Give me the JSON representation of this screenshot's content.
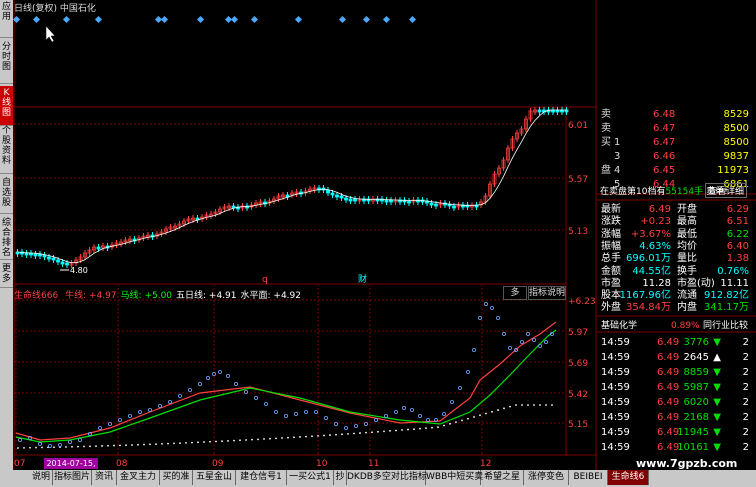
{
  "left_tabs": [
    {
      "label": "应用",
      "active": false
    },
    {
      "label": "分时图",
      "active": false
    },
    {
      "label": "K线图",
      "active": true
    },
    {
      "label": "个股资料",
      "active": false
    },
    {
      "label": "自选股",
      "active": false
    },
    {
      "label": "综合排名",
      "active": false
    },
    {
      "label": "更多",
      "active": false
    }
  ],
  "title": {
    "period": "日线(复权)",
    "name": "中国石化"
  },
  "kline_axis": [
    "6.01",
    "5.57",
    "5.13"
  ],
  "kline_low_label": "4.80",
  "marker_q": "q",
  "marker_cai": "财",
  "indicator_header": {
    "name": "生命线666",
    "items": [
      {
        "label": "牛线:",
        "value": "+4.97",
        "color": "#ff4040"
      },
      {
        "label": "马线:",
        "value": "+5.00",
        "color": "#00ff00"
      },
      {
        "label": "五日线:",
        "value": "+4.91",
        "color": "#ffffff"
      },
      {
        "label": "水平面:",
        "value": "+4.92",
        "color": "#ffffff"
      }
    ],
    "btn1": "多",
    "btn2": "指标说明"
  },
  "indicator_axis": [
    "+6.23",
    "5.97",
    "5.69",
    "5.42",
    "5.15"
  ],
  "xaxis": [
    "07",
    "08",
    "09",
    "10",
    "11",
    "12"
  ],
  "date_label": "2014-07-15,二",
  "order_book": [
    {
      "side": "卖",
      "level": "",
      "price": "6.48",
      "vol": "8529"
    },
    {
      "side": "卖",
      "level": "",
      "price": "6.47",
      "vol": "8500"
    },
    {
      "side": "买",
      "level": "1",
      "price": "6.47",
      "vol": "8500"
    },
    {
      "side": "",
      "level": "3",
      "price": "6.46",
      "vol": "9837"
    },
    {
      "side": "盘",
      "level": "4",
      "price": "6.45",
      "vol": "11973"
    },
    {
      "side": "",
      "level": "5",
      "price": "6.44",
      "vol": "6861"
    }
  ],
  "order_book_side_labels": [
    "买",
    "盘"
  ],
  "sell_info": {
    "text": "在卖盘第10档有",
    "vol": "55154手",
    "suffix": "卖单!",
    "btn": "查看详细"
  },
  "quote_rows": [
    {
      "l1": "最新",
      "v1": "6.49",
      "l2": "开盘",
      "v2": "6.29",
      "c1": "red",
      "c2": "red"
    },
    {
      "l1": "涨跌",
      "v1": "+0.23",
      "l2": "最高",
      "v2": "6.51",
      "c1": "red",
      "c2": "red"
    },
    {
      "l1": "涨幅",
      "v1": "+3.67%",
      "l2": "最低",
      "v2": "6.22",
      "c1": "red",
      "c2": "grn"
    },
    {
      "l1": "振幅",
      "v1": "4.63%",
      "l2": "均价",
      "v2": "6.40",
      "c1": "cyan",
      "c2": "red"
    },
    {
      "l1": "总手",
      "v1": "696.01万",
      "l2": "量比",
      "v2": "1.38",
      "c1": "cyan",
      "c2": "red"
    },
    {
      "l1": "金额",
      "v1": "44.55亿",
      "l2": "换手",
      "v2": "0.76%",
      "c1": "cyan",
      "c2": "cyan"
    },
    {
      "l1": "市盈",
      "v1": "11.28",
      "l2": "市盈(动)",
      "v2": "11.11",
      "c1": "wht",
      "c2": "wht"
    },
    {
      "l1": "股本",
      "v1": "1167.96亿",
      "l2": "流通",
      "v2": "912.82亿",
      "c1": "cyan",
      "c2": "cyan"
    },
    {
      "l1": "外盘",
      "v1": "354.84万",
      "l2": "内盘",
      "v2": "341.17万",
      "c1": "red",
      "c2": "grn"
    }
  ],
  "sector": {
    "name": "基础化学",
    "pct": "0.89%",
    "btn": "同行业比较"
  },
  "ticks": [
    {
      "time": "14:59",
      "price": "6.49",
      "vol": "3776",
      "dir": "down",
      "n": "2"
    },
    {
      "time": "14:59",
      "price": "6.49",
      "vol": "2645",
      "dir": "up",
      "n": "2"
    },
    {
      "time": "14:59",
      "price": "6.49",
      "vol": "8859",
      "dir": "down",
      "n": "2"
    },
    {
      "time": "14:59",
      "price": "6.49",
      "vol": "5987",
      "dir": "down",
      "n": "2"
    },
    {
      "time": "14:59",
      "price": "6.49",
      "vol": "6020",
      "dir": "down",
      "n": "2"
    },
    {
      "time": "14:59",
      "price": "6.49",
      "vol": "2168",
      "dir": "down",
      "n": "2"
    },
    {
      "time": "14:59",
      "price": "6.49",
      "vol": "11945",
      "dir": "down",
      "n": "2"
    },
    {
      "time": "14:59",
      "price": "6.49",
      "vol": "10161",
      "dir": "down",
      "n": "2"
    }
  ],
  "bottom_tabs": [
    {
      "label": "说明",
      "active": false
    },
    {
      "label": "指标图片",
      "active": false
    },
    {
      "label": "资讯",
      "active": false
    },
    {
      "label": "金叉主力",
      "active": false
    },
    {
      "label": "买的准",
      "active": false
    },
    {
      "label": "五星金山",
      "active": false
    },
    {
      "label": "建仓信号1",
      "active": false
    },
    {
      "label": "一买公式1",
      "active": false
    },
    {
      "label": "抄",
      "active": false
    },
    {
      "label": "DKDB多空对比指标",
      "active": false
    },
    {
      "label": "WBB中短买卖",
      "active": false
    },
    {
      "label": "希望之星",
      "active": false
    },
    {
      "label": "涨停变色",
      "active": false
    },
    {
      "label": "BEIBEI",
      "active": false
    },
    {
      "label": "生命线6",
      "active": true
    }
  ],
  "watermark": "www.7gpzb.com",
  "colors": {
    "up": "#ff4040",
    "down": "#00ffff",
    "grid": "#800000",
    "ma": "#ffffff"
  }
}
